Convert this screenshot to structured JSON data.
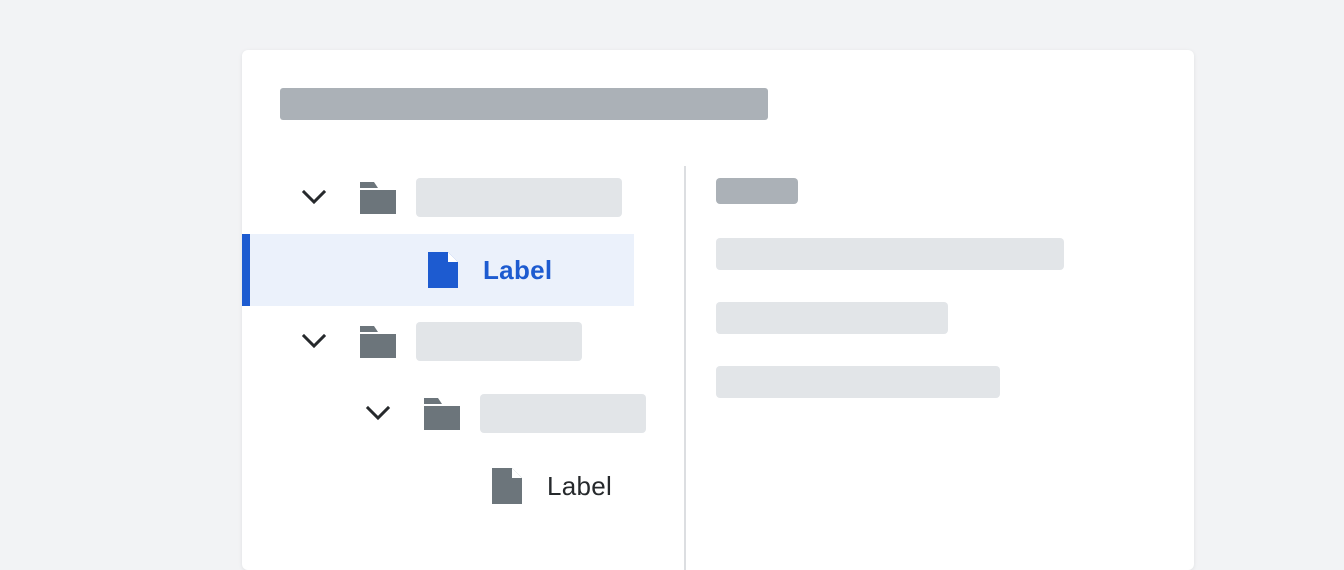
{
  "tree": {
    "selected_item": {
      "label": "Label",
      "icon": "file-icon"
    },
    "leaf_item": {
      "label": "Label",
      "icon": "file-icon"
    },
    "folder_icon": "folder-icon",
    "expand_icon": "chevron-down-icon"
  },
  "colors": {
    "accent": "#1d5bd0",
    "selected_bg": "#ebf1fb",
    "icon_gray": "#6c757b",
    "placeholder_light": "#e2e5e8",
    "placeholder_dark": "#abb1b7",
    "page_bg": "#f2f3f5"
  }
}
